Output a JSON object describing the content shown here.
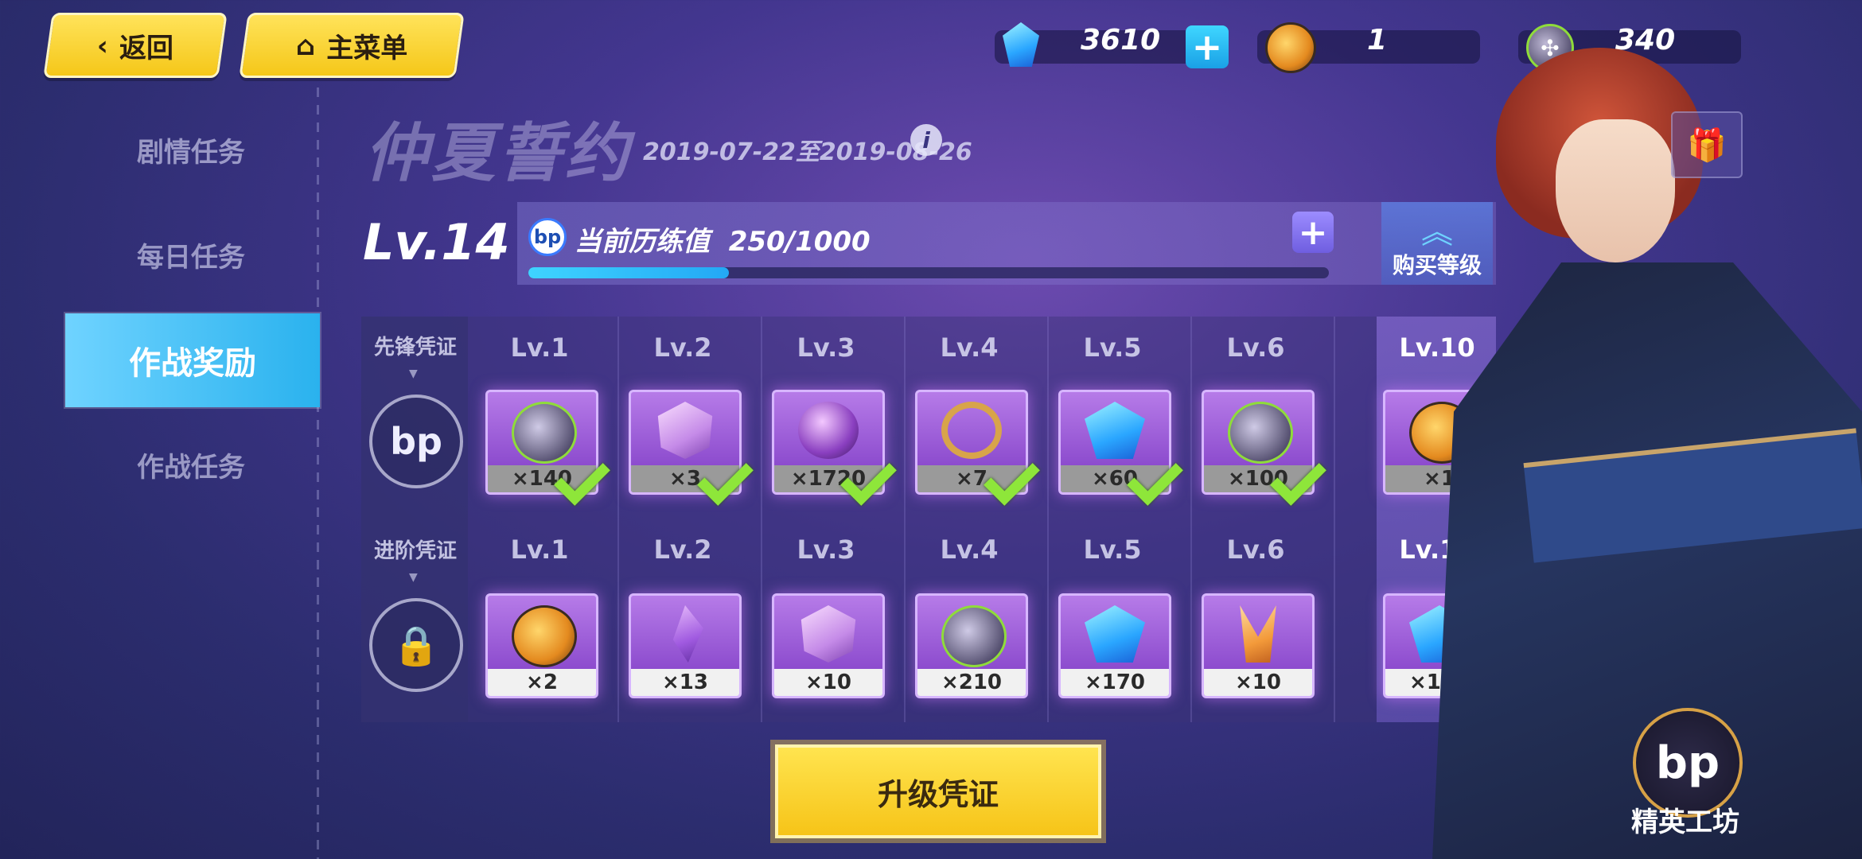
{
  "nav": {
    "back_label": "返回",
    "main_menu_label": "主菜单"
  },
  "currency": {
    "crystal": "3610",
    "sp_coin": "1",
    "bp_coin": "340"
  },
  "sidebar": {
    "items": [
      {
        "label": "剧情任务",
        "active": false
      },
      {
        "label": "每日任务",
        "active": false
      },
      {
        "label": "作战奖励",
        "active": true
      },
      {
        "label": "作战任务",
        "active": false
      }
    ]
  },
  "event": {
    "title": "仲夏誓约",
    "date_range": "2019-07-22至2019-08-26"
  },
  "level": {
    "label": "Lv.14",
    "xp_label": "当前历练值",
    "xp_value": "250/1000",
    "xp_progress": 0.25,
    "buy_level_label": "购买等级"
  },
  "rows": [
    {
      "label": "先锋凭证",
      "rewards": [
        {
          "level": "Lv.1",
          "count": "×140",
          "icon": "bp-coin-icon",
          "claimed": true
        },
        {
          "level": "Lv.2",
          "count": "×3",
          "icon": "pink-crystal-icon",
          "claimed": true
        },
        {
          "level": "Lv.3",
          "count": "×1720",
          "icon": "purple-orb-icon",
          "claimed": true
        },
        {
          "level": "Lv.4",
          "count": "×7",
          "icon": "gold-ring-icon",
          "claimed": true
        },
        {
          "level": "Lv.5",
          "count": "×60",
          "icon": "blue-crystal-icon",
          "claimed": true
        },
        {
          "level": "Lv.6",
          "count": "×100",
          "icon": "bp-coin-icon",
          "claimed": true
        },
        {
          "level": "Lv.10",
          "count": "×1",
          "icon": "amber-orb-icon",
          "claimed": true
        }
      ]
    },
    {
      "label": "进阶凭证",
      "rewards": [
        {
          "level": "Lv.1",
          "count": "×2",
          "icon": "amber-orb-icon",
          "claimed": false
        },
        {
          "level": "Lv.2",
          "count": "×13",
          "icon": "purple-feather-icon",
          "claimed": false
        },
        {
          "level": "Lv.3",
          "count": "×10",
          "icon": "pink-crystal-icon",
          "claimed": false
        },
        {
          "level": "Lv.4",
          "count": "×210",
          "icon": "bp-coin-icon",
          "claimed": false
        },
        {
          "level": "Lv.5",
          "count": "×170",
          "icon": "blue-crystal-icon",
          "claimed": false
        },
        {
          "level": "Lv.6",
          "count": "×10",
          "icon": "orange-shard-icon",
          "claimed": false
        },
        {
          "level": "Lv.10",
          "count": "×170",
          "icon": "blue-crystal-icon",
          "claimed": false
        }
      ]
    }
  ],
  "upgrade_label": "升级凭证",
  "workshop_label": "精英工坊",
  "colors": {
    "accent": "#f6c418",
    "active_tab": "#2ab2ee",
    "check": "#8ee63a"
  }
}
